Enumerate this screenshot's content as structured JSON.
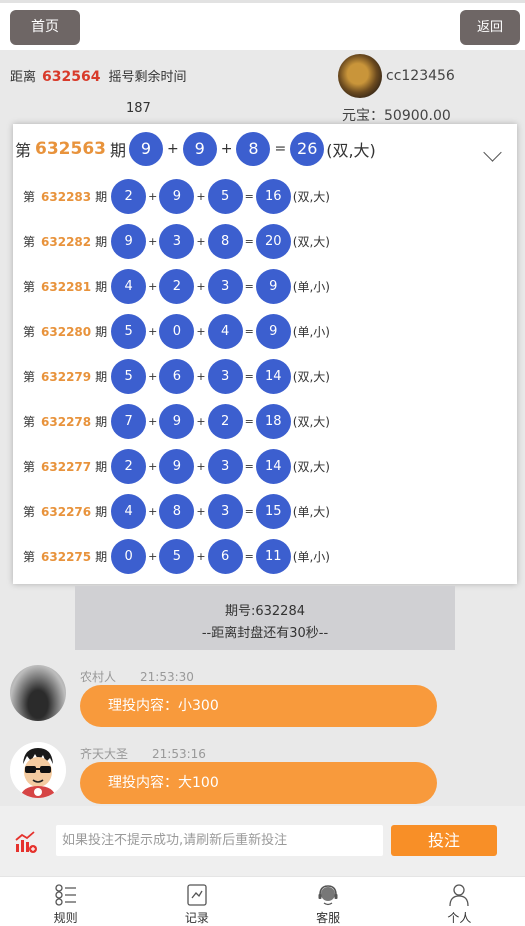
{
  "topbar": {
    "home_label": "首页",
    "back_label": "返回"
  },
  "info": {
    "countdown_prefix": "距离",
    "next_issue": "632564",
    "countdown_suffix": "摇号剩余时间",
    "timer": "187",
    "username": "cc123456",
    "balance": "元宝：50900.00"
  },
  "results": {
    "latest": {
      "prefix": "第",
      "issue": "632563",
      "suffix": "期",
      "n1": "9",
      "n2": "9",
      "n3": "8",
      "sum": "26",
      "tag": "(双,大)"
    },
    "history": [
      {
        "issue": "632283",
        "n1": "2",
        "n2": "9",
        "n3": "5",
        "sum": "16",
        "tag": "(双,大)"
      },
      {
        "issue": "632282",
        "n1": "9",
        "n2": "3",
        "n3": "8",
        "sum": "20",
        "tag": "(双,大)"
      },
      {
        "issue": "632281",
        "n1": "4",
        "n2": "2",
        "n3": "3",
        "sum": "9",
        "tag": "(单,小)"
      },
      {
        "issue": "632280",
        "n1": "5",
        "n2": "0",
        "n3": "4",
        "sum": "9",
        "tag": "(单,小)"
      },
      {
        "issue": "632279",
        "n1": "5",
        "n2": "6",
        "n3": "3",
        "sum": "14",
        "tag": "(双,大)"
      },
      {
        "issue": "632278",
        "n1": "7",
        "n2": "9",
        "n3": "2",
        "sum": "18",
        "tag": "(双,大)"
      },
      {
        "issue": "632277",
        "n1": "2",
        "n2": "9",
        "n3": "3",
        "sum": "14",
        "tag": "(双,大)"
      },
      {
        "issue": "632276",
        "n1": "4",
        "n2": "8",
        "n3": "3",
        "sum": "15",
        "tag": "(单,大)"
      },
      {
        "issue": "632275",
        "n1": "0",
        "n2": "5",
        "n3": "6",
        "sum": "11",
        "tag": "(单,小)"
      }
    ],
    "prefix": "第",
    "suffix": "期",
    "plus": "+",
    "equals": "="
  },
  "period_notice": {
    "line1": "期号:632284",
    "line2": "--距离封盘还有30秒--"
  },
  "messages": [
    {
      "user": "农村人",
      "time": "21:53:30",
      "content": "理投内容：小300"
    },
    {
      "user": "齐天大圣",
      "time": "21:53:16",
      "content": "理投内容：大100"
    }
  ],
  "bet": {
    "placeholder": "如果投注不提示成功,请刷新后重新投注",
    "button_label": "投注"
  },
  "tabs": [
    {
      "label": "规则",
      "icon": "rules-icon"
    },
    {
      "label": "记录",
      "icon": "records-icon"
    },
    {
      "label": "客服",
      "icon": "customer-service-icon"
    },
    {
      "label": "个人",
      "icon": "profile-icon"
    }
  ],
  "colors": {
    "ball": "#3c5fcf",
    "issue": "#e8933c",
    "bubble": "#f89a3c",
    "bet_button": "#f88f27",
    "top_button": "#6e6665"
  }
}
